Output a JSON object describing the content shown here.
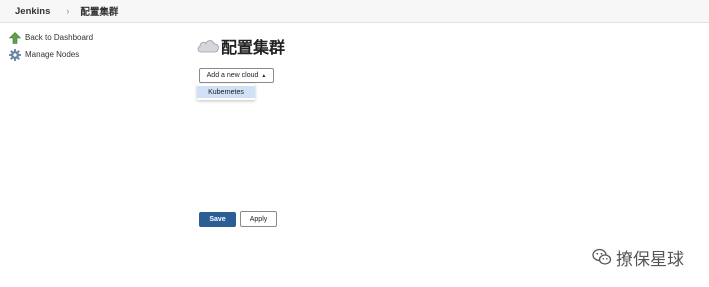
{
  "breadcrumb": {
    "root": "Jenkins",
    "separator": "›",
    "current": "配置集群"
  },
  "sidebar": {
    "items": [
      {
        "label": "Back to Dashboard",
        "icon": "up-arrow-icon"
      },
      {
        "label": "Manage Nodes",
        "icon": "gear-icon"
      }
    ]
  },
  "main": {
    "title": "配置集群",
    "title_icon": "cloud-icon",
    "add_cloud_label": "Add a new cloud",
    "add_cloud_caret": "▲",
    "dropdown_items": [
      "Kubernetes"
    ],
    "save_label": "Save",
    "apply_label": "Apply"
  },
  "watermark": {
    "text": "撩保星球",
    "icon": "wechat-icon"
  },
  "colors": {
    "save_button": "#2c5e96",
    "dropdown_highlight": "#cfe0f7",
    "topbar_bg": "#f7f7f7"
  }
}
